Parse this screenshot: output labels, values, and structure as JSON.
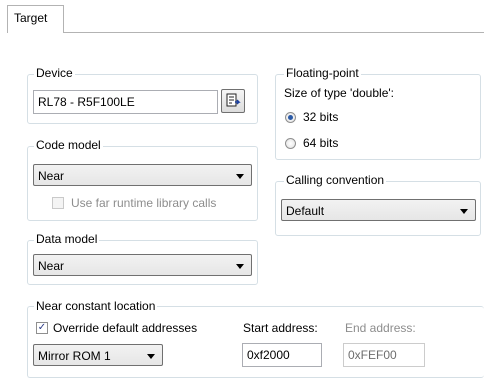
{
  "tab": {
    "label": "Target"
  },
  "device": {
    "legend": "Device",
    "value": "RL78 - R5F100LE",
    "browse_icon": "device-select-icon"
  },
  "code_model": {
    "legend": "Code model",
    "selected": "Near",
    "far_runtime_label": "Use far runtime library calls",
    "far_runtime_checked": false
  },
  "data_model": {
    "legend": "Data model",
    "selected": "Near"
  },
  "floating_point": {
    "legend": "Floating-point",
    "size_label": "Size of type 'double':",
    "options": [
      "32 bits",
      "64 bits"
    ],
    "selected_index": 0
  },
  "calling_convention": {
    "legend": "Calling convention",
    "selected": "Default"
  },
  "near_constant": {
    "legend": "Near constant location",
    "override_label": "Override default addresses",
    "override_checked": true,
    "override_mark": "✓",
    "mirror_selected": "Mirror ROM 1",
    "start_label": "Start address:",
    "start_value": "0xf2000",
    "end_label": "End address:",
    "end_value": "0xFEF00"
  }
}
